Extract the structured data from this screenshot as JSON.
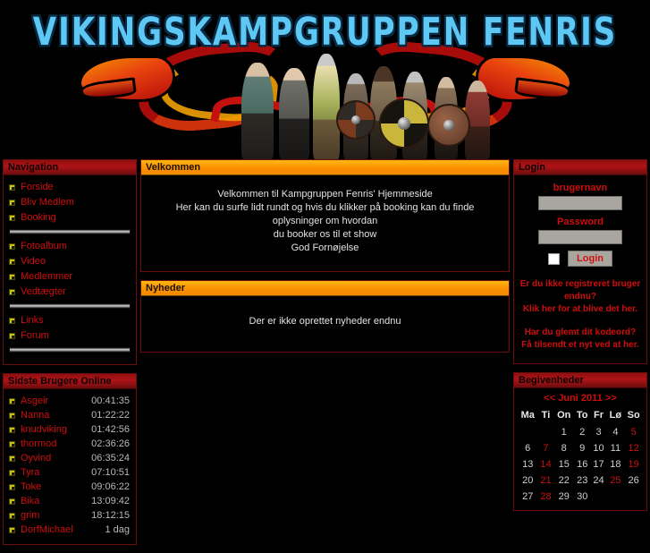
{
  "site": {
    "banner_title": "VIKINGSKAMPGRUPPEN FENRIS"
  },
  "navigation": {
    "title": "Navigation",
    "groups": [
      {
        "items": [
          {
            "label": "Forside"
          },
          {
            "label": "Bliv Medlem"
          },
          {
            "label": "Booking"
          }
        ]
      },
      {
        "items": [
          {
            "label": "Fotoalbum"
          },
          {
            "label": "Video"
          },
          {
            "label": "Medlemmer"
          },
          {
            "label": "Vedtægter"
          }
        ]
      },
      {
        "items": [
          {
            "label": "Links"
          },
          {
            "label": "Forum"
          }
        ]
      }
    ]
  },
  "online": {
    "title": "Sidste Brugere Online",
    "users": [
      {
        "name": "Asgeir",
        "time": "00:41:35"
      },
      {
        "name": "Nanna",
        "time": "01:22:22"
      },
      {
        "name": "knudviking",
        "time": "01:42:56"
      },
      {
        "name": "thormod",
        "time": "02:36:26"
      },
      {
        "name": "Oyvind",
        "time": "06:35:24"
      },
      {
        "name": "Tyra",
        "time": "07:10:51"
      },
      {
        "name": "Toke",
        "time": "09:06:22"
      },
      {
        "name": "Bika",
        "time": "13:09:42"
      },
      {
        "name": "grim",
        "time": "18:12:15"
      },
      {
        "name": "DorfMichael",
        "time": "1 dag"
      }
    ]
  },
  "welcome": {
    "title": "Velkommen",
    "lines": [
      "Velkommen til Kampgruppen Fenris' Hjemmeside",
      "Her kan du surfe lidt rundt og hvis du klikker på booking kan du finde oplysninger om hvordan",
      "du booker os til et show",
      "God Fornøjelse"
    ]
  },
  "news": {
    "title": "Nyheder",
    "empty_text": "Der er ikke oprettet nyheder endnu"
  },
  "login": {
    "title": "Login",
    "username_label": "brugernavn",
    "username_value": "",
    "password_label": "Password",
    "password_value": "",
    "submit_label": "Login",
    "register_question": "Er du ikke registreret bruger endnu?",
    "register_link": "Klik her for at blive det her.",
    "forgot_question": "Har du glemt dit kodeord?",
    "forgot_link": "Få tilsendt et nyt ved at her."
  },
  "events": {
    "title": "Begivenheder",
    "prev_label": "<<",
    "month_label": "Juni 2011",
    "next_label": ">>",
    "weekdays": [
      "Ma",
      "Ti",
      "On",
      "To",
      "Fr",
      "Lø",
      "So"
    ],
    "weeks": [
      [
        {
          "d": "",
          "hl": false
        },
        {
          "d": "",
          "hl": false
        },
        {
          "d": "1",
          "hl": false
        },
        {
          "d": "2",
          "hl": false
        },
        {
          "d": "3",
          "hl": false
        },
        {
          "d": "4",
          "hl": false
        },
        {
          "d": "5",
          "hl": true
        }
      ],
      [
        {
          "d": "6",
          "hl": false
        },
        {
          "d": "7",
          "hl": true
        },
        {
          "d": "8",
          "hl": false
        },
        {
          "d": "9",
          "hl": false
        },
        {
          "d": "10",
          "hl": false
        },
        {
          "d": "11",
          "hl": false
        },
        {
          "d": "12",
          "hl": true
        }
      ],
      [
        {
          "d": "13",
          "hl": false
        },
        {
          "d": "14",
          "hl": true
        },
        {
          "d": "15",
          "hl": false
        },
        {
          "d": "16",
          "hl": false
        },
        {
          "d": "17",
          "hl": false
        },
        {
          "d": "18",
          "hl": false
        },
        {
          "d": "19",
          "hl": true
        }
      ],
      [
        {
          "d": "20",
          "hl": false
        },
        {
          "d": "21",
          "hl": true
        },
        {
          "d": "22",
          "hl": false
        },
        {
          "d": "23",
          "hl": false
        },
        {
          "d": "24",
          "hl": false
        },
        {
          "d": "25",
          "hl": true
        },
        {
          "d": "26",
          "hl": false
        }
      ],
      [
        {
          "d": "27",
          "hl": false
        },
        {
          "d": "28",
          "hl": true
        },
        {
          "d": "29",
          "hl": false
        },
        {
          "d": "30",
          "hl": false
        },
        {
          "d": "",
          "hl": false
        },
        {
          "d": "",
          "hl": false
        },
        {
          "d": "",
          "hl": false
        }
      ]
    ]
  },
  "colors": {
    "background": "#000000",
    "panel_border": "#6b0d0d",
    "header_red": "#b01417",
    "header_orange": "#fb9003",
    "link_red": "#cf0d0d",
    "text_light": "#e3e3e3",
    "banner_title_blue": "#5ec8f5"
  }
}
